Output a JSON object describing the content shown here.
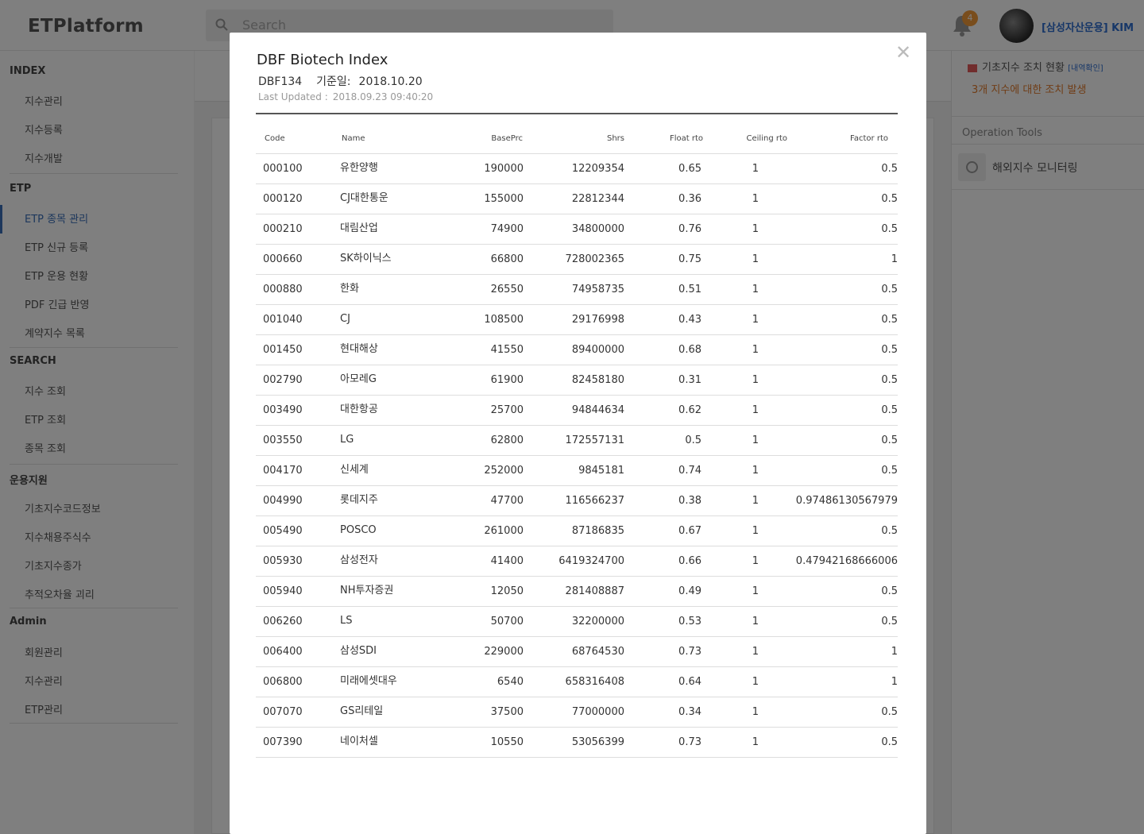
{
  "app": {
    "logo": "ETPlatform",
    "search_placeholder": "Search",
    "notification_count": "4",
    "user_name": "[삼성자산운용] KIM"
  },
  "sidebar": {
    "sections": [
      {
        "title": "INDEX",
        "items": [
          "지수관리",
          "지수등록",
          "지수개발"
        ]
      },
      {
        "title": "ETP",
        "items": [
          "ETP 종목 관리",
          "ETP 신규 등록",
          "ETP 운용 현황",
          "PDF 긴급 반영",
          "계약지수 목록"
        ]
      },
      {
        "title": "SEARCH",
        "items": [
          "지수 조회",
          "ETP 조회",
          "종목 조회"
        ]
      },
      {
        "title": "운용지원",
        "items": [
          "기초지수코드정보",
          "지수채용주식수",
          "기초지수종가",
          "추적오차율 괴리"
        ]
      },
      {
        "title": "Admin",
        "items": [
          "회원관리",
          "지수관리",
          "ETP관리"
        ]
      }
    ],
    "active_item": "ETP 종목 관리"
  },
  "right_panel": {
    "alert_title": "기초지수 조치 현황",
    "alert_link": "[내역확인]",
    "alert_message": "3개 지수에 대한 조치 발생",
    "ops_title": "Operation Tools",
    "tool_label": "해외지수 모니터링"
  },
  "modal": {
    "title": "DBF Biotech Index",
    "code": "DBF134",
    "base_date_label": "기준일:",
    "base_date": "2018.10.20",
    "updated_label": "Last Updated :",
    "updated_value": "2018.09.23 09:40:20",
    "close_icon": "close-icon",
    "columns": [
      "Code",
      "Name",
      "BasePrc",
      "Shrs",
      "Float rto",
      "Ceiling rto",
      "Factor rto"
    ],
    "rows": [
      [
        "000100",
        "유한양행",
        "190000",
        "12209354",
        "0.65",
        "1",
        "0.5"
      ],
      [
        "000120",
        "CJ대한통운",
        "155000",
        "22812344",
        "0.36",
        "1",
        "0.5"
      ],
      [
        "000210",
        "대림산업",
        "74900",
        "34800000",
        "0.76",
        "1",
        "0.5"
      ],
      [
        "000660",
        "SK하이닉스",
        "66800",
        "728002365",
        "0.75",
        "1",
        "1"
      ],
      [
        "000880",
        "한화",
        "26550",
        "74958735",
        "0.51",
        "1",
        "0.5"
      ],
      [
        "001040",
        "CJ",
        "108500",
        "29176998",
        "0.43",
        "1",
        "0.5"
      ],
      [
        "001450",
        "현대해상",
        "41550",
        "89400000",
        "0.68",
        "1",
        "0.5"
      ],
      [
        "002790",
        "아모레G",
        "61900",
        "82458180",
        "0.31",
        "1",
        "0.5"
      ],
      [
        "003490",
        "대한항공",
        "25700",
        "94844634",
        "0.62",
        "1",
        "0.5"
      ],
      [
        "003550",
        "LG",
        "62800",
        "172557131",
        "0.5",
        "1",
        "0.5"
      ],
      [
        "004170",
        "신세계",
        "252000",
        "9845181",
        "0.74",
        "1",
        "0.5"
      ],
      [
        "004990",
        "롯데지주",
        "47700",
        "116566237",
        "0.38",
        "1",
        "0.97486130567979"
      ],
      [
        "005490",
        "POSCO",
        "261000",
        "87186835",
        "0.67",
        "1",
        "0.5"
      ],
      [
        "005930",
        "삼성전자",
        "41400",
        "6419324700",
        "0.66",
        "1",
        "0.47942168666006"
      ],
      [
        "005940",
        "NH투자증권",
        "12050",
        "281408887",
        "0.49",
        "1",
        "0.5"
      ],
      [
        "006260",
        "LS",
        "50700",
        "32200000",
        "0.53",
        "1",
        "0.5"
      ],
      [
        "006400",
        "삼성SDI",
        "229000",
        "68764530",
        "0.73",
        "1",
        "1"
      ],
      [
        "006800",
        "미래에셋대우",
        "6540",
        "658316408",
        "0.64",
        "1",
        "1"
      ],
      [
        "007070",
        "GS리테일",
        "37500",
        "77000000",
        "0.34",
        "1",
        "0.5"
      ],
      [
        "007390",
        "네이처셀",
        "10550",
        "53056399",
        "0.73",
        "1",
        "0.5"
      ]
    ]
  },
  "colors": {
    "accent": "#3a6fb8",
    "warning": "#e07a2c",
    "badge": "#f29a38",
    "user_link": "#2f6fd0"
  }
}
